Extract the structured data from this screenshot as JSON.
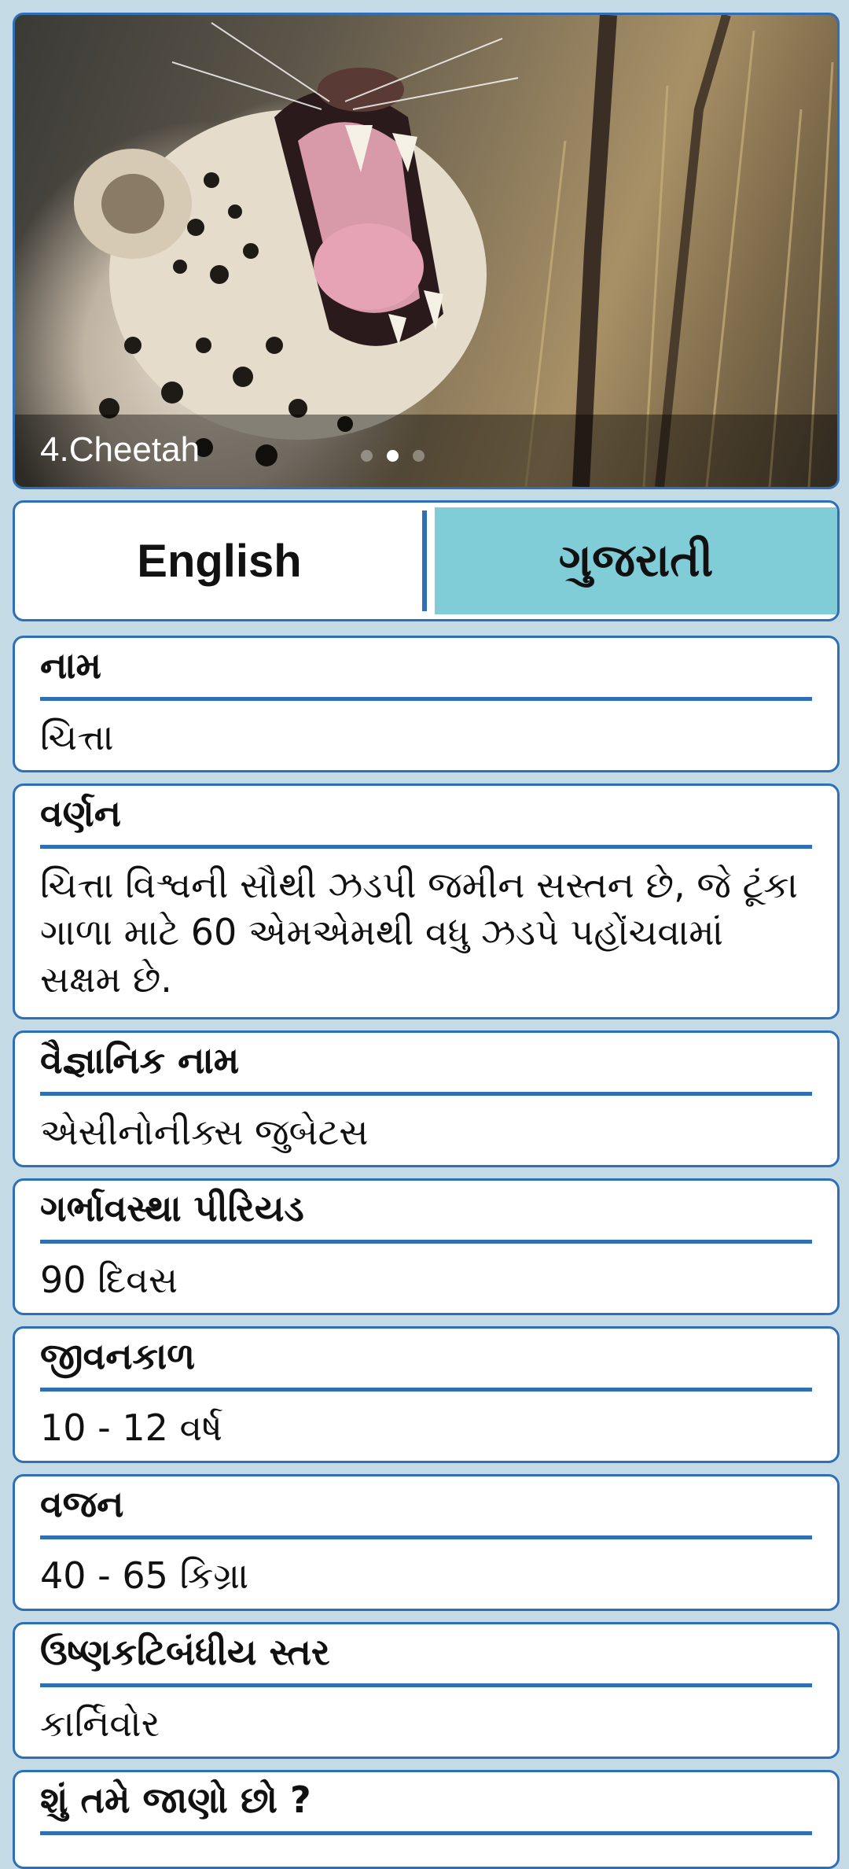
{
  "hero": {
    "title": "4.Cheetah",
    "image_subject": "yawning leopard",
    "slide_count": 3,
    "active_slide": 1
  },
  "tabs": {
    "english": "English",
    "gujarati": "ગુજરાતી",
    "active": "gujarati",
    "active_color": "#80cdd8"
  },
  "fields": [
    {
      "label": "નામ",
      "value": "ચિત્તા"
    },
    {
      "label": "વર્ણન",
      "value": "ચિત્તા વિશ્વની સૌથી ઝડપી જમીન સસ્તન છે, જે ટૂંકા ગાળા માટે 60 એમએમથી વધુ ઝડપે પહોંચવામાં સક્ષમ છે."
    },
    {
      "label": "વૈજ્ઞાનિક નામ",
      "value": "એસીનોનીક્સ જુબેટસ"
    },
    {
      "label": "ગર્ભાવસ્થા પીરિયડ",
      "value": "90 દિવસ"
    },
    {
      "label": "જીવનકાળ",
      "value": "10 - 12 વર્ષ"
    },
    {
      "label": "વજન",
      "value": "40 - 65 કિગ્રા"
    },
    {
      "label": "ઉષ્ણકટિબંધીય સ્તર",
      "value": "કાર્નિવોર"
    },
    {
      "label": "શું તમે જાણો છો ?",
      "value": ""
    }
  ],
  "colors": {
    "border": "#2f6fb5",
    "background": "#c4dae4",
    "card": "#ffffff"
  }
}
